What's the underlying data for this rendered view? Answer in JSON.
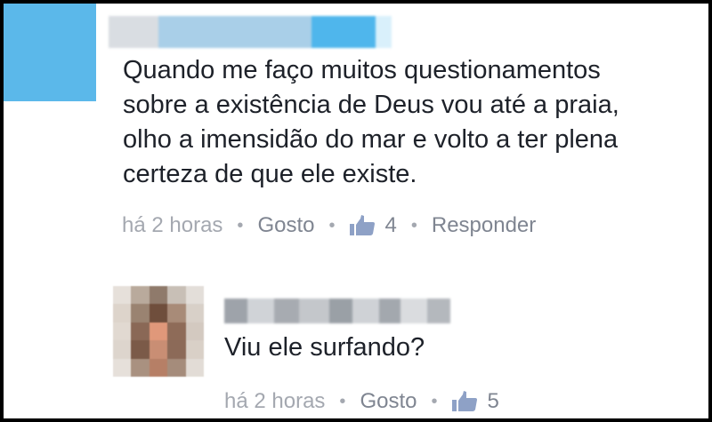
{
  "comment": {
    "text": "Quando me faço muitos questionamentos\nsobre a existência de Deus vou até a praia,\nolho a imensidão do mar e volto a ter plena\ncerteza de que ele existe.",
    "time": "há 2 horas",
    "like_label": "Gosto",
    "like_count": "4",
    "reply_label": "Responder",
    "avatar_color": "#5bb8ea"
  },
  "reply": {
    "text": "Viu ele surfando?",
    "time": "há 2 horas",
    "like_label": "Gosto",
    "like_count": "5"
  },
  "icons": {
    "like": "thumbs-up-icon"
  },
  "colors": {
    "text": "#1d2129",
    "meta": "#90949c",
    "like_icon": "#8ea1c6"
  }
}
